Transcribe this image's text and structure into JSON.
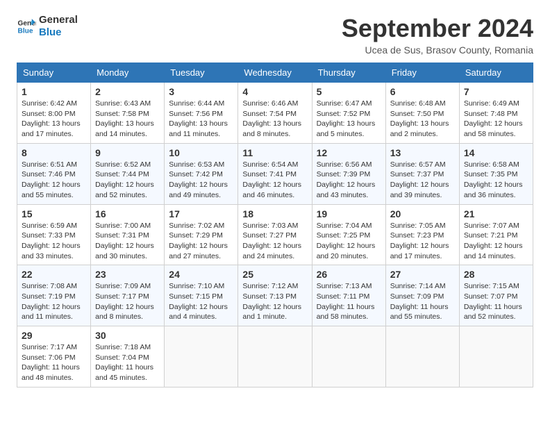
{
  "logo": {
    "line1": "General",
    "line2": "Blue"
  },
  "title": "September 2024",
  "location": "Ucea de Sus, Brasov County, Romania",
  "weekdays": [
    "Sunday",
    "Monday",
    "Tuesday",
    "Wednesday",
    "Thursday",
    "Friday",
    "Saturday"
  ],
  "weeks": [
    [
      {
        "day": "1",
        "info": "Sunrise: 6:42 AM\nSunset: 8:00 PM\nDaylight: 13 hours\nand 17 minutes."
      },
      {
        "day": "2",
        "info": "Sunrise: 6:43 AM\nSunset: 7:58 PM\nDaylight: 13 hours\nand 14 minutes."
      },
      {
        "day": "3",
        "info": "Sunrise: 6:44 AM\nSunset: 7:56 PM\nDaylight: 13 hours\nand 11 minutes."
      },
      {
        "day": "4",
        "info": "Sunrise: 6:46 AM\nSunset: 7:54 PM\nDaylight: 13 hours\nand 8 minutes."
      },
      {
        "day": "5",
        "info": "Sunrise: 6:47 AM\nSunset: 7:52 PM\nDaylight: 13 hours\nand 5 minutes."
      },
      {
        "day": "6",
        "info": "Sunrise: 6:48 AM\nSunset: 7:50 PM\nDaylight: 13 hours\nand 2 minutes."
      },
      {
        "day": "7",
        "info": "Sunrise: 6:49 AM\nSunset: 7:48 PM\nDaylight: 12 hours\nand 58 minutes."
      }
    ],
    [
      {
        "day": "8",
        "info": "Sunrise: 6:51 AM\nSunset: 7:46 PM\nDaylight: 12 hours\nand 55 minutes."
      },
      {
        "day": "9",
        "info": "Sunrise: 6:52 AM\nSunset: 7:44 PM\nDaylight: 12 hours\nand 52 minutes."
      },
      {
        "day": "10",
        "info": "Sunrise: 6:53 AM\nSunset: 7:42 PM\nDaylight: 12 hours\nand 49 minutes."
      },
      {
        "day": "11",
        "info": "Sunrise: 6:54 AM\nSunset: 7:41 PM\nDaylight: 12 hours\nand 46 minutes."
      },
      {
        "day": "12",
        "info": "Sunrise: 6:56 AM\nSunset: 7:39 PM\nDaylight: 12 hours\nand 43 minutes."
      },
      {
        "day": "13",
        "info": "Sunrise: 6:57 AM\nSunset: 7:37 PM\nDaylight: 12 hours\nand 39 minutes."
      },
      {
        "day": "14",
        "info": "Sunrise: 6:58 AM\nSunset: 7:35 PM\nDaylight: 12 hours\nand 36 minutes."
      }
    ],
    [
      {
        "day": "15",
        "info": "Sunrise: 6:59 AM\nSunset: 7:33 PM\nDaylight: 12 hours\nand 33 minutes."
      },
      {
        "day": "16",
        "info": "Sunrise: 7:00 AM\nSunset: 7:31 PM\nDaylight: 12 hours\nand 30 minutes."
      },
      {
        "day": "17",
        "info": "Sunrise: 7:02 AM\nSunset: 7:29 PM\nDaylight: 12 hours\nand 27 minutes."
      },
      {
        "day": "18",
        "info": "Sunrise: 7:03 AM\nSunset: 7:27 PM\nDaylight: 12 hours\nand 24 minutes."
      },
      {
        "day": "19",
        "info": "Sunrise: 7:04 AM\nSunset: 7:25 PM\nDaylight: 12 hours\nand 20 minutes."
      },
      {
        "day": "20",
        "info": "Sunrise: 7:05 AM\nSunset: 7:23 PM\nDaylight: 12 hours\nand 17 minutes."
      },
      {
        "day": "21",
        "info": "Sunrise: 7:07 AM\nSunset: 7:21 PM\nDaylight: 12 hours\nand 14 minutes."
      }
    ],
    [
      {
        "day": "22",
        "info": "Sunrise: 7:08 AM\nSunset: 7:19 PM\nDaylight: 12 hours\nand 11 minutes."
      },
      {
        "day": "23",
        "info": "Sunrise: 7:09 AM\nSunset: 7:17 PM\nDaylight: 12 hours\nand 8 minutes."
      },
      {
        "day": "24",
        "info": "Sunrise: 7:10 AM\nSunset: 7:15 PM\nDaylight: 12 hours\nand 4 minutes."
      },
      {
        "day": "25",
        "info": "Sunrise: 7:12 AM\nSunset: 7:13 PM\nDaylight: 12 hours\nand 1 minute."
      },
      {
        "day": "26",
        "info": "Sunrise: 7:13 AM\nSunset: 7:11 PM\nDaylight: 11 hours\nand 58 minutes."
      },
      {
        "day": "27",
        "info": "Sunrise: 7:14 AM\nSunset: 7:09 PM\nDaylight: 11 hours\nand 55 minutes."
      },
      {
        "day": "28",
        "info": "Sunrise: 7:15 AM\nSunset: 7:07 PM\nDaylight: 11 hours\nand 52 minutes."
      }
    ],
    [
      {
        "day": "29",
        "info": "Sunrise: 7:17 AM\nSunset: 7:06 PM\nDaylight: 11 hours\nand 48 minutes."
      },
      {
        "day": "30",
        "info": "Sunrise: 7:18 AM\nSunset: 7:04 PM\nDaylight: 11 hours\nand 45 minutes."
      },
      {
        "day": "",
        "info": ""
      },
      {
        "day": "",
        "info": ""
      },
      {
        "day": "",
        "info": ""
      },
      {
        "day": "",
        "info": ""
      },
      {
        "day": "",
        "info": ""
      }
    ]
  ]
}
